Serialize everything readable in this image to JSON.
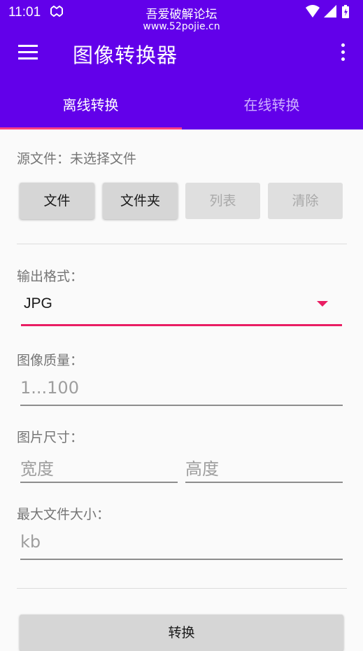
{
  "status_bar": {
    "time": "11:01",
    "watermark_line1": "吾爱破解论坛",
    "watermark_line2": "www.52pojie.cn"
  },
  "app_bar": {
    "title": "图像转换器",
    "menu_icon": "hamburger-menu-icon",
    "more_icon": "more-vert-icon"
  },
  "tabs": [
    {
      "label": "离线转换",
      "active": true
    },
    {
      "label": "在线转换",
      "active": false
    }
  ],
  "source": {
    "label": "源文件：",
    "value": "未选择文件"
  },
  "buttons": {
    "file": "文件",
    "folder": "文件夹",
    "list": "列表",
    "clear": "清除"
  },
  "output_format": {
    "label": "输出格式：",
    "selected": "JPG"
  },
  "quality": {
    "label": "图像质量：",
    "placeholder": "1...100"
  },
  "size": {
    "label": "图片尺寸：",
    "width_placeholder": "宽度",
    "height_placeholder": "高度"
  },
  "max_file_size": {
    "label": "最大文件大小：",
    "placeholder": "kb"
  },
  "convert_button": "转换",
  "colors": {
    "primary": "#6200ea",
    "accent": "#ff4081",
    "spinner_accent": "#e91e63"
  }
}
